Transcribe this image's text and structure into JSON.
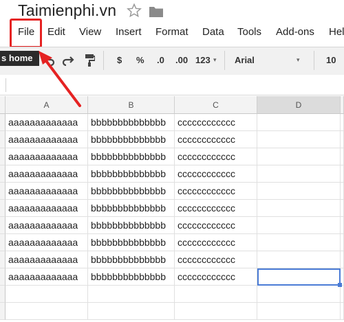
{
  "app": {
    "doc_title": "Taimienphi.vn"
  },
  "icons": {
    "star": "star-icon",
    "folder": "folder-icon"
  },
  "menu": [
    "File",
    "Edit",
    "View",
    "Insert",
    "Format",
    "Data",
    "Tools",
    "Add-ons",
    "Help"
  ],
  "tooltip": "s home",
  "toolbar": {
    "currency": "$",
    "percent": "%",
    "dec_decrease": ".0",
    "dec_increase": ".00",
    "more_formats": "123",
    "font": "Arial",
    "font_size": "10"
  },
  "grid": {
    "columns": [
      "A",
      "B",
      "C",
      "D"
    ],
    "rows": [
      [
        "aaaaaaaaaaaaa",
        "bbbbbbbbbbbbbb",
        "cccccccccccc",
        ""
      ],
      [
        "aaaaaaaaaaaaa",
        "bbbbbbbbbbbbbb",
        "cccccccccccc",
        ""
      ],
      [
        "aaaaaaaaaaaaa",
        "bbbbbbbbbbbbbb",
        "cccccccccccc",
        ""
      ],
      [
        "aaaaaaaaaaaaa",
        "bbbbbbbbbbbbbb",
        "cccccccccccc",
        ""
      ],
      [
        "aaaaaaaaaaaaa",
        "bbbbbbbbbbbbbb",
        "cccccccccccc",
        ""
      ],
      [
        "aaaaaaaaaaaaa",
        "bbbbbbbbbbbbbb",
        "cccccccccccc",
        ""
      ],
      [
        "aaaaaaaaaaaaa",
        "bbbbbbbbbbbbbb",
        "cccccccccccc",
        ""
      ],
      [
        "aaaaaaaaaaaaa",
        "bbbbbbbbbbbbbb",
        "cccccccccccc",
        ""
      ],
      [
        "aaaaaaaaaaaaa",
        "bbbbbbbbbbbbbb",
        "cccccccccccc",
        ""
      ],
      [
        "aaaaaaaaaaaaa",
        "bbbbbbbbbbbbbb",
        "cccccccccccc",
        ""
      ],
      [
        "",
        "",
        "",
        ""
      ],
      [
        "",
        "",
        "",
        ""
      ]
    ],
    "active_cell": "D10"
  },
  "colors": {
    "highlight": "#e52222",
    "selection": "#4a7bd6"
  }
}
